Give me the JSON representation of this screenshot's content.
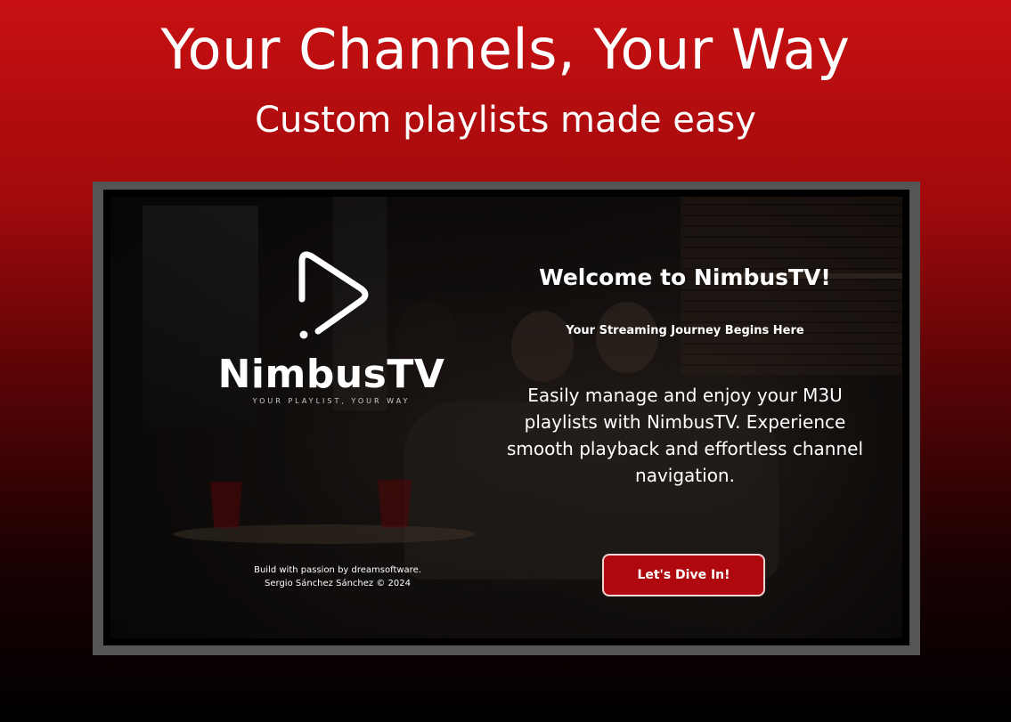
{
  "promo": {
    "title": "Your Channels, Your Way",
    "subtitle": "Custom playlists made easy"
  },
  "app": {
    "logo": {
      "name": "NimbusTV",
      "tagline": "YOUR PLAYLIST, YOUR WAY",
      "icon": "play-icon"
    },
    "credits": {
      "line1": "Build with passion by dreamsoftware.",
      "line2": "Sergio Sánchez Sánchez © 2024"
    },
    "welcome": {
      "title": "Welcome to NimbusTV!",
      "subtitle": "Your Streaming Journey Begins Here",
      "body": "Easily manage and enjoy your M3U playlists with NimbusTV. Experience smooth playback and effortless channel navigation."
    },
    "cta": {
      "label": "Let's Dive In!"
    }
  },
  "colors": {
    "accent": "#b0080f",
    "background_top": "#c81012",
    "background_bottom": "#000000",
    "tv_frame": "#555555"
  }
}
